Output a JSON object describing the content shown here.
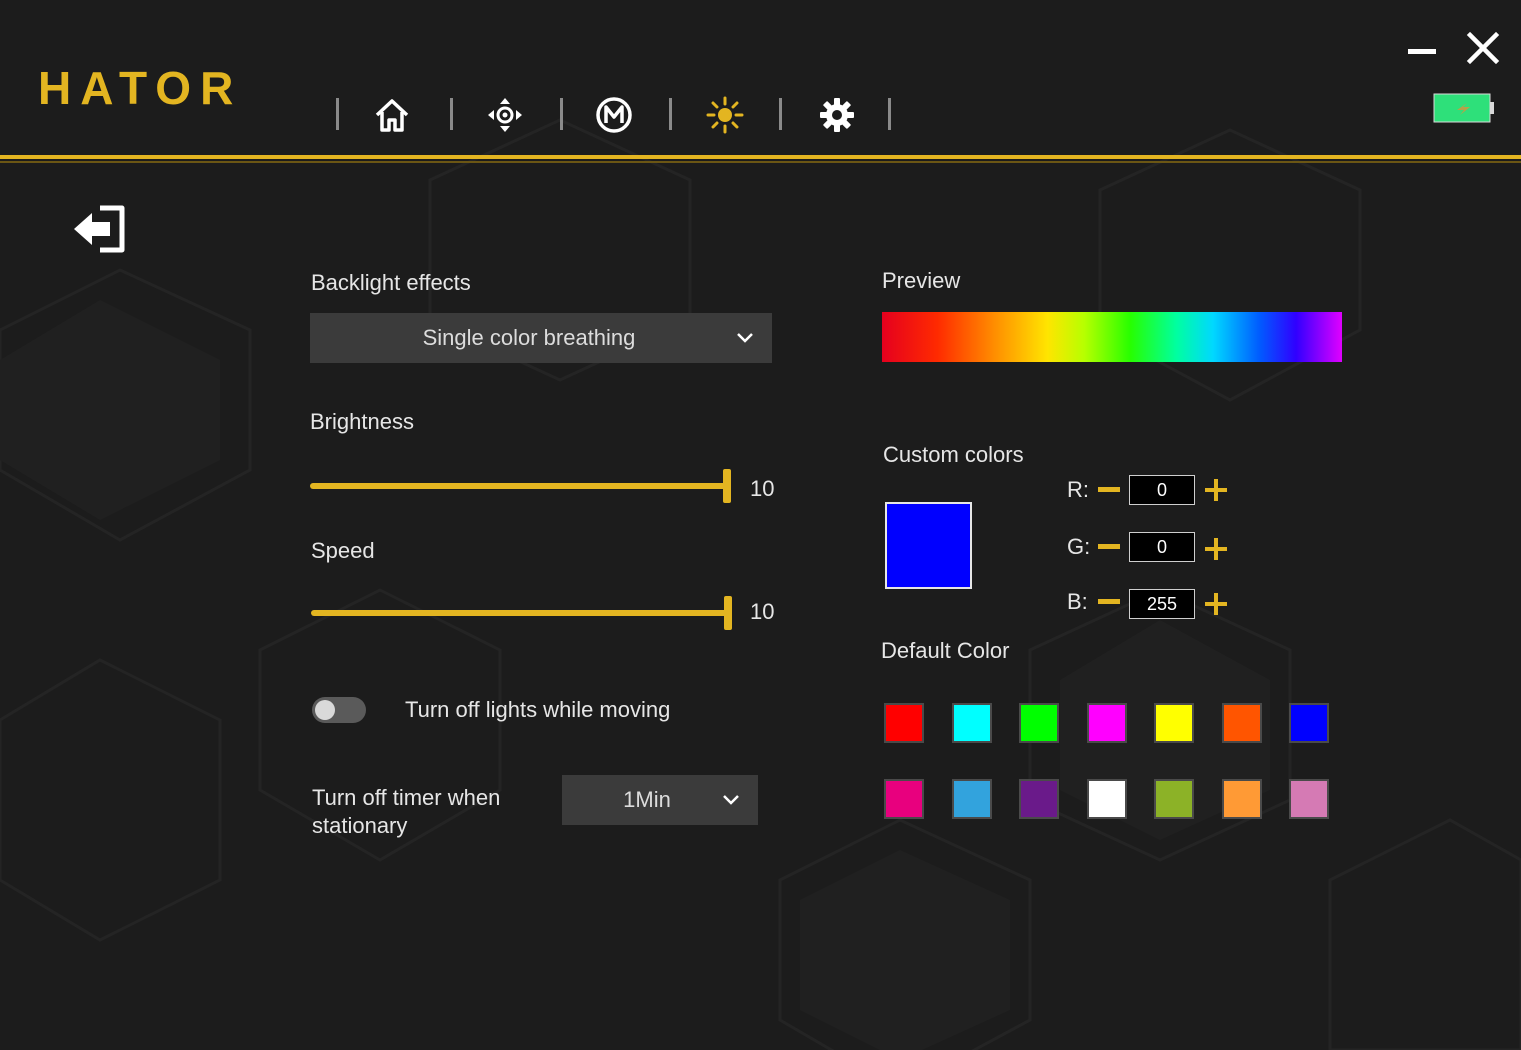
{
  "app": {
    "logo": "HATOR"
  },
  "window": {
    "minimize_icon": "minimize-icon",
    "close_icon": "close-icon"
  },
  "battery": {
    "icon": "battery-icon",
    "color": "#2ee07a"
  },
  "nav": {
    "items": [
      {
        "name": "home",
        "icon": "home-icon"
      },
      {
        "name": "buttons",
        "icon": "move-arrows-icon"
      },
      {
        "name": "macro",
        "icon": "macro-m-icon"
      },
      {
        "name": "lighting",
        "icon": "sun-icon",
        "active": true
      },
      {
        "name": "settings",
        "icon": "gear-icon"
      }
    ]
  },
  "back": {
    "icon": "back-arrow-icon"
  },
  "backlight": {
    "label": "Backlight effects",
    "selected": "Single color breathing"
  },
  "brightness": {
    "label": "Brightness",
    "value": "10",
    "level": 1.0
  },
  "speed": {
    "label": "Speed",
    "value": "10",
    "level": 1.0
  },
  "move_toggle": {
    "label": "Turn off lights while moving",
    "on": false
  },
  "timer": {
    "label_line1": "Turn off timer when",
    "label_line2": "stationary",
    "selected": "1Min"
  },
  "preview": {
    "label": "Preview"
  },
  "custom": {
    "label": "Custom colors",
    "swatch_color": "#0000ff",
    "r_label": "R:",
    "r_value": "0",
    "g_label": "G:",
    "g_value": "0",
    "b_label": "B:",
    "b_value": "255"
  },
  "defaults": {
    "label": "Default Color",
    "row1": [
      "#ff0000",
      "#00ffff",
      "#00ff00",
      "#ff00ff",
      "#ffff00",
      "#ff5500",
      "#0000ff"
    ],
    "row2": [
      "#e8007e",
      "#32a3dd",
      "#6a1a8a",
      "#ffffff",
      "#8cb227",
      "#ff9a35",
      "#d57ab4"
    ]
  },
  "accent_color": "#e3b521"
}
